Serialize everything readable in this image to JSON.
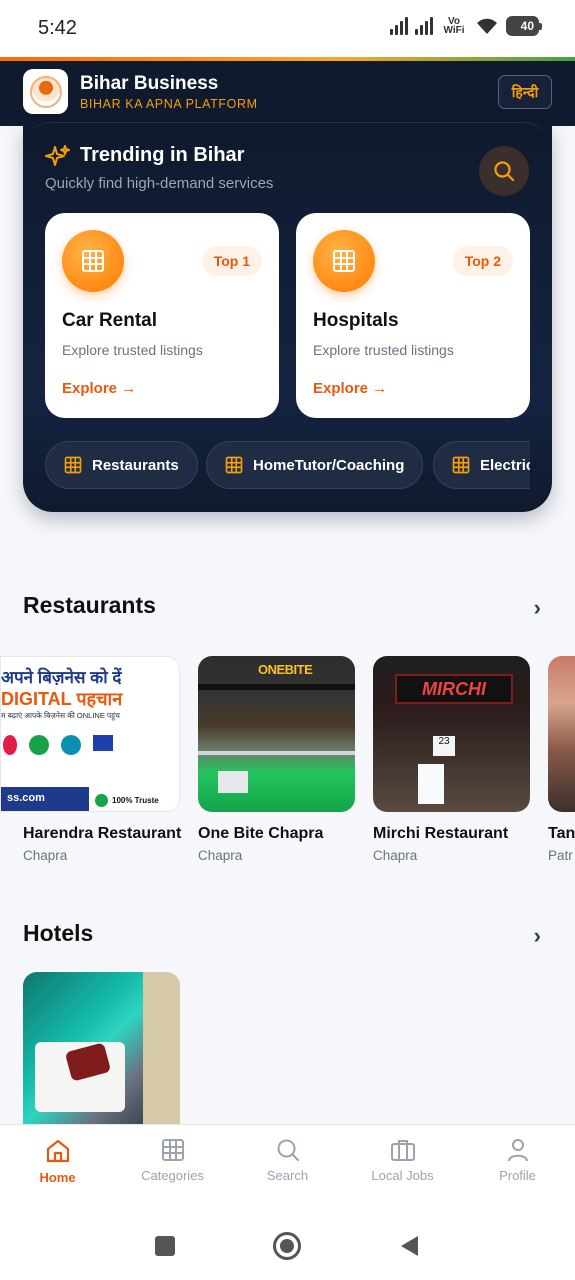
{
  "status_bar": {
    "time": "5:42",
    "network": "Vo WiFi",
    "battery": "40"
  },
  "header": {
    "title": "Bihar Business",
    "subtitle": "BIHAR KA APNA PLATFORM",
    "lang_button": "हिन्दी"
  },
  "trending": {
    "title": "Trending in Bihar",
    "subtitle": "Quickly find high-demand services",
    "cards": [
      {
        "badge": "Top 1",
        "name": "Car Rental",
        "desc": "Explore trusted listings",
        "cta": "Explore →"
      },
      {
        "badge": "Top 2",
        "name": "Hospitals",
        "desc": "Explore trusted listings",
        "cta": "Explore →"
      }
    ],
    "chips": [
      "Restaurants",
      "HomeTutor/Coaching",
      "Electric"
    ]
  },
  "restaurants": {
    "title": "Restaurants",
    "items": [
      {
        "name": "Harendra Restaurant",
        "city": "Chapra"
      },
      {
        "name": "One Bite Chapra",
        "city": "Chapra"
      },
      {
        "name": "Mirchi Restaurant",
        "city": "Chapra"
      },
      {
        "name": "Tan",
        "city": "Patr"
      }
    ],
    "promo": {
      "line1": "अपने बिज़नेस को दें",
      "line2": "DIGITAL पहचान",
      "line3": "म बढ़ाएं आपके बिज़नेस की ONLINE पहुंच",
      "domain": "ss.com",
      "trust": "100% Truste"
    },
    "sign_onebite": "ONEBITE",
    "sign_mirchi": "MIRCHI"
  },
  "hotels": {
    "title": "Hotels"
  },
  "nav": [
    {
      "label": "Home",
      "icon": "home-icon"
    },
    {
      "label": "Categories",
      "icon": "grid-icon"
    },
    {
      "label": "Search",
      "icon": "search-icon"
    },
    {
      "label": "Local Jobs",
      "icon": "briefcase-icon"
    },
    {
      "label": "Profile",
      "icon": "user-icon"
    }
  ],
  "colors": {
    "accent": "#e8590c",
    "dark": "#0f1a2e",
    "orange": "#ff7a00"
  }
}
